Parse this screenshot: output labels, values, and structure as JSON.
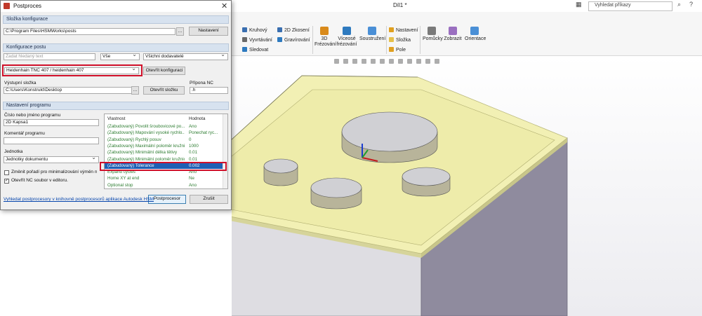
{
  "app": {
    "title": "Díl1 *",
    "search_placeholder": "Vyhledat příkazy"
  },
  "ribbon": {
    "groups": [
      {
        "items": [
          "Kruhový",
          "Vyvrtávání",
          "Sledovat"
        ]
      },
      {
        "items": [
          "2D Zkosení",
          "Gravírování"
        ]
      }
    ],
    "big_buttons": [
      "3D Frézování",
      "Víceosé frézování",
      "Soustružení"
    ],
    "stack_items": [
      "Nastavení",
      "Složka",
      "Pole"
    ],
    "right_buttons": [
      "Pomůcky",
      "Zobrazit",
      "Orientace"
    ]
  },
  "dialog": {
    "title": "Postproces",
    "sections": {
      "config_folder": "Složka konfigurace",
      "post_config": "Konfigurace postu",
      "program_settings": "Nastavení programu"
    },
    "config_path": "C:\\Program Files\\HSMWorks\\posts",
    "settings_button": "Nastavení",
    "search_placeholder": "Zadat hledaný text",
    "filter_all": "Vše",
    "vendor_filter": "Všichni dodavatelé",
    "post_selected": "Heidenhain TNC 407 / heidenhain 407",
    "open_config_button": "Otevřít konfiguraci",
    "output_folder_label": "Výstupní složka",
    "output_folder": "C:\\Users\\Konstrukt\\Desktop",
    "open_folder_button": "Otevřít složku",
    "nc_ext_label": "Přípona NC",
    "nc_ext": ".h",
    "program_name_label": "Číslo nebo jméno programu",
    "program_name": "2D Kapsa1",
    "comment_label": "Komentář programu",
    "comment_value": "",
    "unit_label": "Jednotka",
    "unit_value": "Jednotky dokumentu",
    "reorder_label": "Změnit pořadí pro minimalizování výměn nástrojů",
    "open_nc_label": "Otevřít NC soubor v editoru.",
    "table_headers": [
      "Vlastnost",
      "Hodnota"
    ],
    "properties": [
      [
        "(Zabudovaný) Povolit šroubovicové po...",
        "Ano"
      ],
      [
        "(Zabudovaný) Mapování vysoké rychlo...",
        "Ponechat ryc..."
      ],
      [
        "(Zabudovaný) Rychlý posuv",
        "0"
      ],
      [
        "(Zabudovaný) Maximální poloměr kružnice",
        "1000"
      ],
      [
        "(Zabudovaný) Minimální délka tětivy",
        "0.01"
      ],
      [
        "(Zabudovaný) Minimální poloměr kružnice",
        "0.01"
      ],
      [
        "(Zabudovaný) Tolerance",
        "0.002"
      ],
      [
        "Expand cycles",
        "Ano"
      ],
      [
        "Home XY at end",
        "Ne"
      ],
      [
        "Optional stop",
        "Ano"
      ]
    ],
    "selected_row": 6,
    "postprocessor_button": "Postprocesor",
    "cancel_button": "Zrušit",
    "library_link": "Vyhledat postprocesory v knihovně postprocesorů aplikace Autodesk HSM"
  },
  "colors": {
    "highlight_red": "#d0102a",
    "selection_blue": "#1f5fb4",
    "stock_yellow": "#f2f0b4",
    "body_grey": "#dedde2"
  }
}
